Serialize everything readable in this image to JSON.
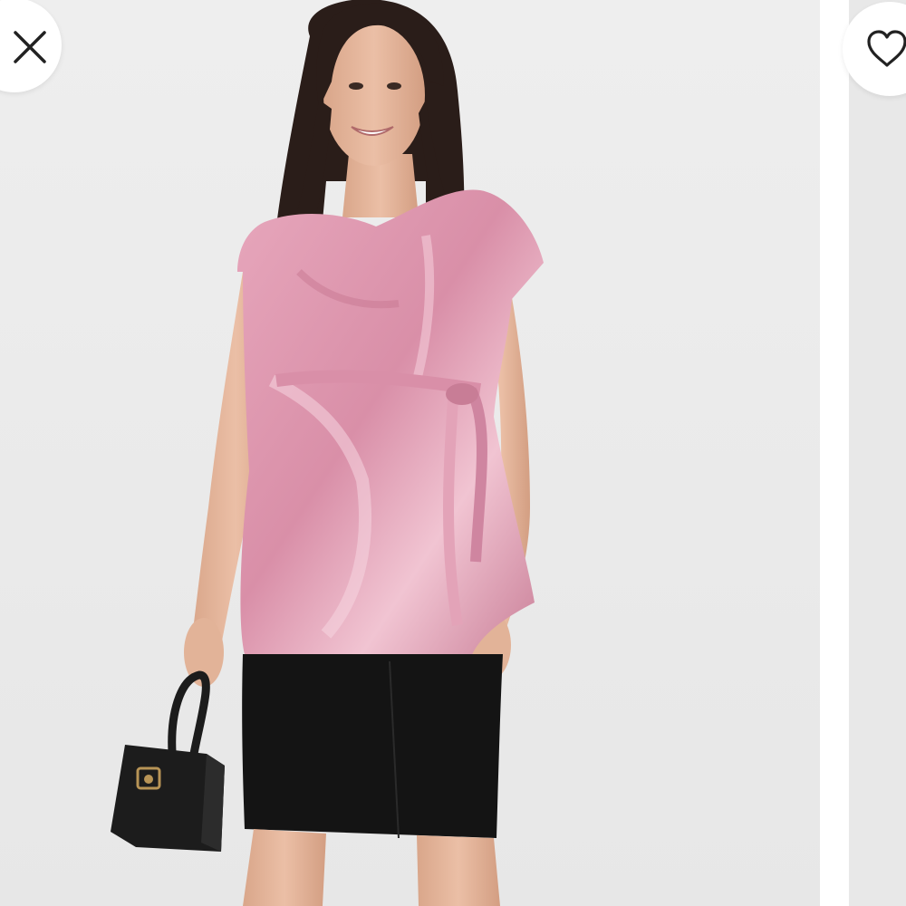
{
  "screen": {
    "background": "#ebebeb",
    "divider_color": "#ffffff"
  },
  "gallery": {
    "current_image": {
      "alt": "",
      "colors": {
        "top": "#d98fa8",
        "skirt": "#141414",
        "bag": "#1c1c1c",
        "hair": "#2a1d19",
        "skin": "#e2b398"
      }
    }
  },
  "controls": {
    "close_icon": "close-icon",
    "favorite_icon": "heart-outline-icon"
  }
}
